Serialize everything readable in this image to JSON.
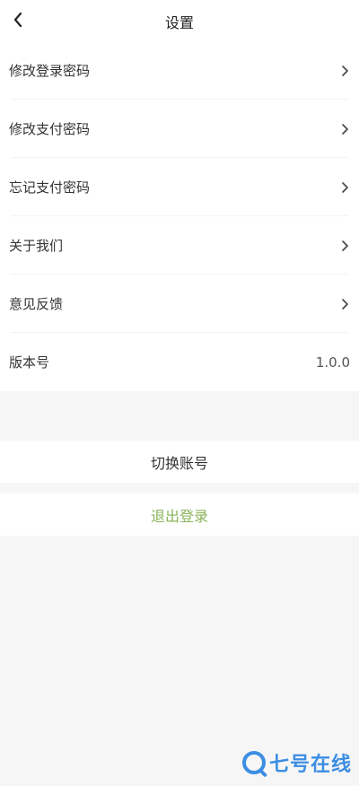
{
  "header": {
    "title": "设置",
    "back_icon": "chevron-left-icon"
  },
  "menu": {
    "items": [
      {
        "label": "修改登录密码"
      },
      {
        "label": "修改支付密码"
      },
      {
        "label": "忘记支付密码"
      },
      {
        "label": "关于我们"
      },
      {
        "label": "意见反馈"
      }
    ],
    "version": {
      "label": "版本号",
      "value": "1.0.0"
    }
  },
  "actions": {
    "switch_label": "切换账号",
    "logout_label": "退出登录"
  },
  "watermark": {
    "text": "七号在线"
  },
  "colors": {
    "accent_logout": "#8ab35a",
    "watermark": "#3c8ee3"
  }
}
